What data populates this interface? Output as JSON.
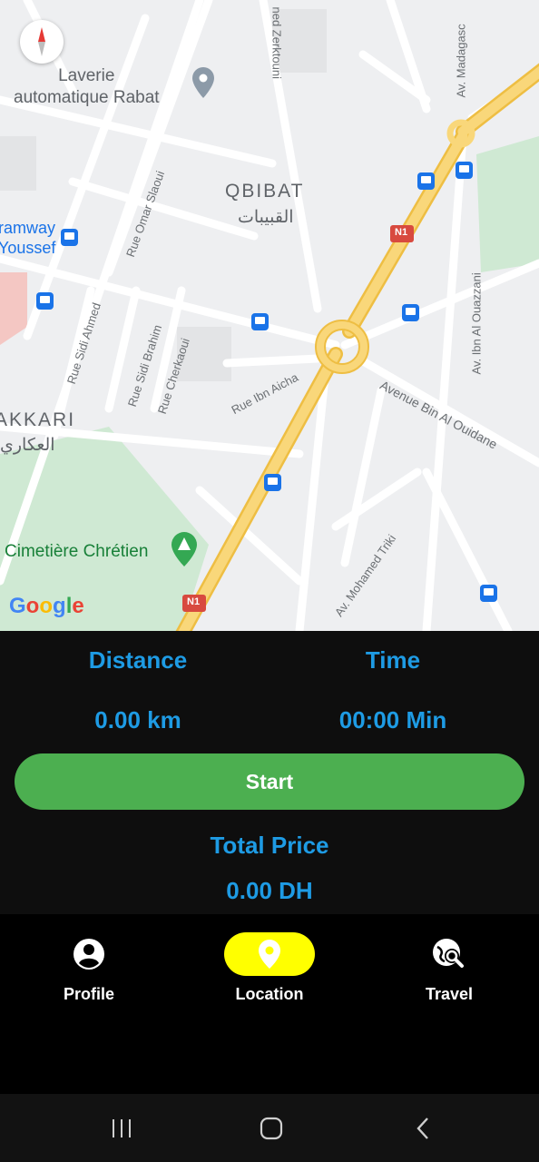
{
  "map": {
    "poi_laverie": "Laverie\nautomatique Rabat",
    "district_qbibat": "QBIBAT",
    "district_qbibat_ar": "القبيبات",
    "district_akkari": "AKKARI",
    "district_akkari_ar": "العكاري",
    "tramway": "ramway\nYoussef",
    "cemetery": "Cimetière Chrétien",
    "street_zerktouni": "ned Zerktouni",
    "street_madagascar": "Av. Madagasc",
    "street_omar_slaoui": "Rue Omar Slaoui",
    "street_sidi_ahmed": "Rue Sidi Ahmed",
    "street_sidi_brahim": "Rue Sidi Brahim",
    "street_cherkaoui": "Rue Cherkaoui",
    "street_ibn_aicha": "Rue Ibn Aicha",
    "street_bin_al_ouidane": "Avenue Bin Al Ouidane",
    "street_ibn_al_ouazzani": "Av. Ibn Al Ouazzani",
    "street_mohamed_triki": "Av. Mohamed Triki",
    "road_badge_n1": "N1",
    "google_logo": "Google",
    "colors": {
      "road_major": "#f9c85a",
      "road_minor": "#ffffff",
      "park": "#cfe9d3",
      "background": "#eeeff1"
    }
  },
  "stats": {
    "distance_label": "Distance",
    "distance_value": "0.00 km",
    "time_label": "Time",
    "time_value": "00:00 Min",
    "total_price_label": "Total Price",
    "total_price_value": "0.00 DH",
    "accent_color": "#1e9be4"
  },
  "start_button": {
    "label": "Start",
    "color": "#4caf50"
  },
  "bottom_nav": {
    "items": [
      {
        "label": "Profile",
        "icon": "profile-icon"
      },
      {
        "label": "Location",
        "icon": "location-pin-icon",
        "active": true
      },
      {
        "label": "Travel",
        "icon": "travel-search-icon"
      }
    ],
    "active_color": "#ffff00"
  },
  "system_nav": {
    "recents": "recents-icon",
    "home": "home-icon",
    "back": "back-icon"
  }
}
